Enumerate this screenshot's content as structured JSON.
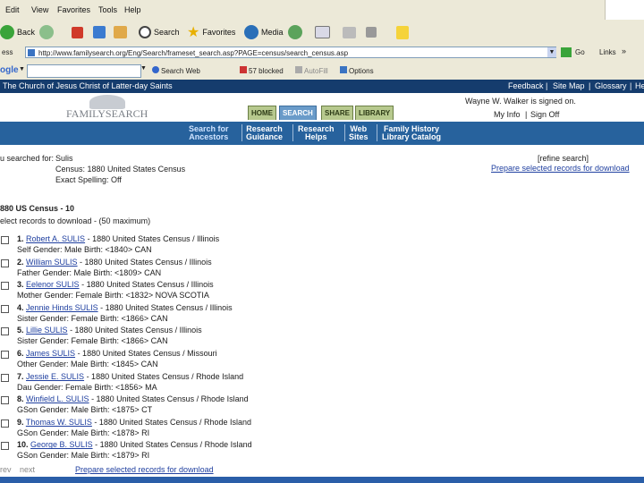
{
  "menu": [
    "Edit",
    "View",
    "Favorites",
    "Tools",
    "Help"
  ],
  "toolbar": {
    "back": "Back",
    "search": "Search",
    "favorites": "Favorites",
    "media": "Media"
  },
  "address": {
    "label": "ess",
    "url": "http://www.familysearch.org/Eng/Search/frameset_search.asp?PAGE=census/search_census.asp",
    "go": "Go",
    "links": "Links"
  },
  "google": {
    "logo": "ogle",
    "search_web": "Search Web",
    "blocked": "57 blocked",
    "autofill": "AutoFill",
    "options": "Options"
  },
  "church_bar": {
    "title": "The Church of Jesus Christ of Latter-day Saints",
    "links": [
      "Feedback",
      "Site Map",
      "Glossary",
      "He"
    ]
  },
  "header": {
    "logo_text": "FAMILYSEARCH",
    "tabs": [
      "HOME",
      "SEARCH",
      "SHARE",
      "LIBRARY"
    ],
    "signed_on": "Wayne W. Walker is signed on.",
    "my_info": "My Info",
    "sign_off": "Sign Off"
  },
  "nav": [
    {
      "line1": "Search for",
      "line2": "Ancestors"
    },
    {
      "line1": "Research",
      "line2": "Guidance"
    },
    {
      "line1": "Research",
      "line2": "Helps"
    },
    {
      "line1": "Web",
      "line2": "Sites"
    },
    {
      "line1": "Family History",
      "line2": "Library Catalog"
    }
  ],
  "searched": {
    "label": "u searched for:",
    "values": [
      "Sulis",
      "Census: 1880 United States Census",
      "Exact Spelling: Off"
    ],
    "refine": "[refine search]",
    "prepare": "Prepare selected records for download"
  },
  "results": {
    "heading": "880 US Census - 10",
    "instruction": "elect records to download - (50 maximum)",
    "records": [
      {
        "num": "1.",
        "name": "Robert A. SULIS",
        "rest": " - 1880 United States Census / Illinois",
        "detail": "Self   Gender: Male   Birth: <1840> CAN"
      },
      {
        "num": "2.",
        "name": "William SULIS",
        "rest": " - 1880 United States Census / Illinois",
        "detail": "Father   Gender: Male   Birth: <1809> CAN"
      },
      {
        "num": "3.",
        "name": "Eelenor SULIS",
        "rest": " - 1880 United States Census / Illinois",
        "detail": "Mother   Gender: Female   Birth: <1832> NOVA SCOTIA"
      },
      {
        "num": "4.",
        "name": "Jennie Hinds SULIS",
        "rest": " - 1880 United States Census / Illinois",
        "detail": "Sister   Gender: Female   Birth: <1866> CAN"
      },
      {
        "num": "5.",
        "name": "Lillie SULIS",
        "rest": " - 1880 United States Census / Illinois",
        "detail": "Sister   Gender: Female   Birth: <1866> CAN"
      },
      {
        "num": "6.",
        "name": "James SULIS",
        "rest": " - 1880 United States Census / Missouri",
        "detail": "Other   Gender: Male   Birth: <1845> CAN"
      },
      {
        "num": "7.",
        "name": "Jessie E. SULIS",
        "rest": " - 1880 United States Census / Rhode Island",
        "detail": "Dau   Gender: Female   Birth: <1856> MA"
      },
      {
        "num": "8.",
        "name": "Winfield L. SULIS",
        "rest": " - 1880 United States Census / Rhode Island",
        "detail": "GSon   Gender: Male   Birth: <1875> CT"
      },
      {
        "num": "9.",
        "name": "Thomas W. SULIS",
        "rest": " - 1880 United States Census / Rhode Island",
        "detail": "GSon   Gender: Male   Birth: <1878> RI"
      },
      {
        "num": "10.",
        "name": "George B. SULIS",
        "rest": " - 1880 United States Census / Rhode Island",
        "detail": "GSon   Gender: Male   Birth: <1879> RI"
      }
    ],
    "prev": "rev",
    "next": "next",
    "prepare_bottom": "Prepare selected records for download"
  },
  "colors": {
    "chrome": "#ece9d8",
    "church_bar": "#153c6d",
    "nav": "#27629d",
    "link": "#2040a0",
    "tab_search": "#6a9bc9",
    "tab_other": "#b7c98e"
  }
}
